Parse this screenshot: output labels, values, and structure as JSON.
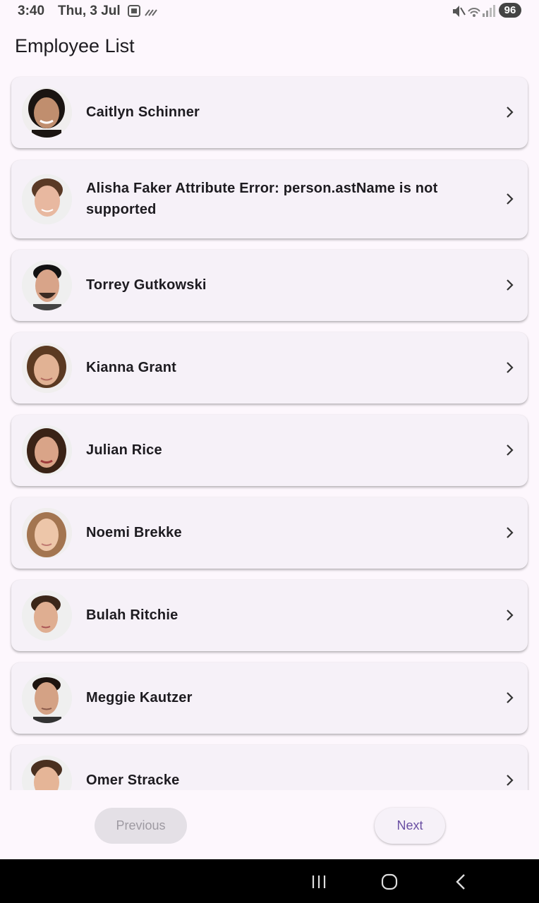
{
  "status_bar": {
    "time": "3:40",
    "date": "Thu, 3 Jul",
    "battery": "96",
    "icons": [
      "screenshot-icon",
      "data-saver-icon",
      "mute-icon",
      "wifi-icon",
      "signal-icon"
    ]
  },
  "app_bar": {
    "title": "Employee List"
  },
  "employees": [
    {
      "name": "Caitlyn Schinner"
    },
    {
      "name": "Alisha Faker Attribute Error: person.astName is not supported"
    },
    {
      "name": "Torrey Gutkowski"
    },
    {
      "name": "Kianna Grant"
    },
    {
      "name": "Julian Rice"
    },
    {
      "name": "Noemi Brekke"
    },
    {
      "name": "Bulah Ritchie"
    },
    {
      "name": "Meggie Kautzer"
    },
    {
      "name": "Omer Stracke"
    }
  ],
  "pagination": {
    "previous_label": "Previous",
    "next_label": "Next",
    "previous_enabled": false
  },
  "colors": {
    "background": "#fdf7fd",
    "card": "#f6f1f8",
    "accent": "#6a4fa3",
    "disabled": "#e4e0e6"
  }
}
